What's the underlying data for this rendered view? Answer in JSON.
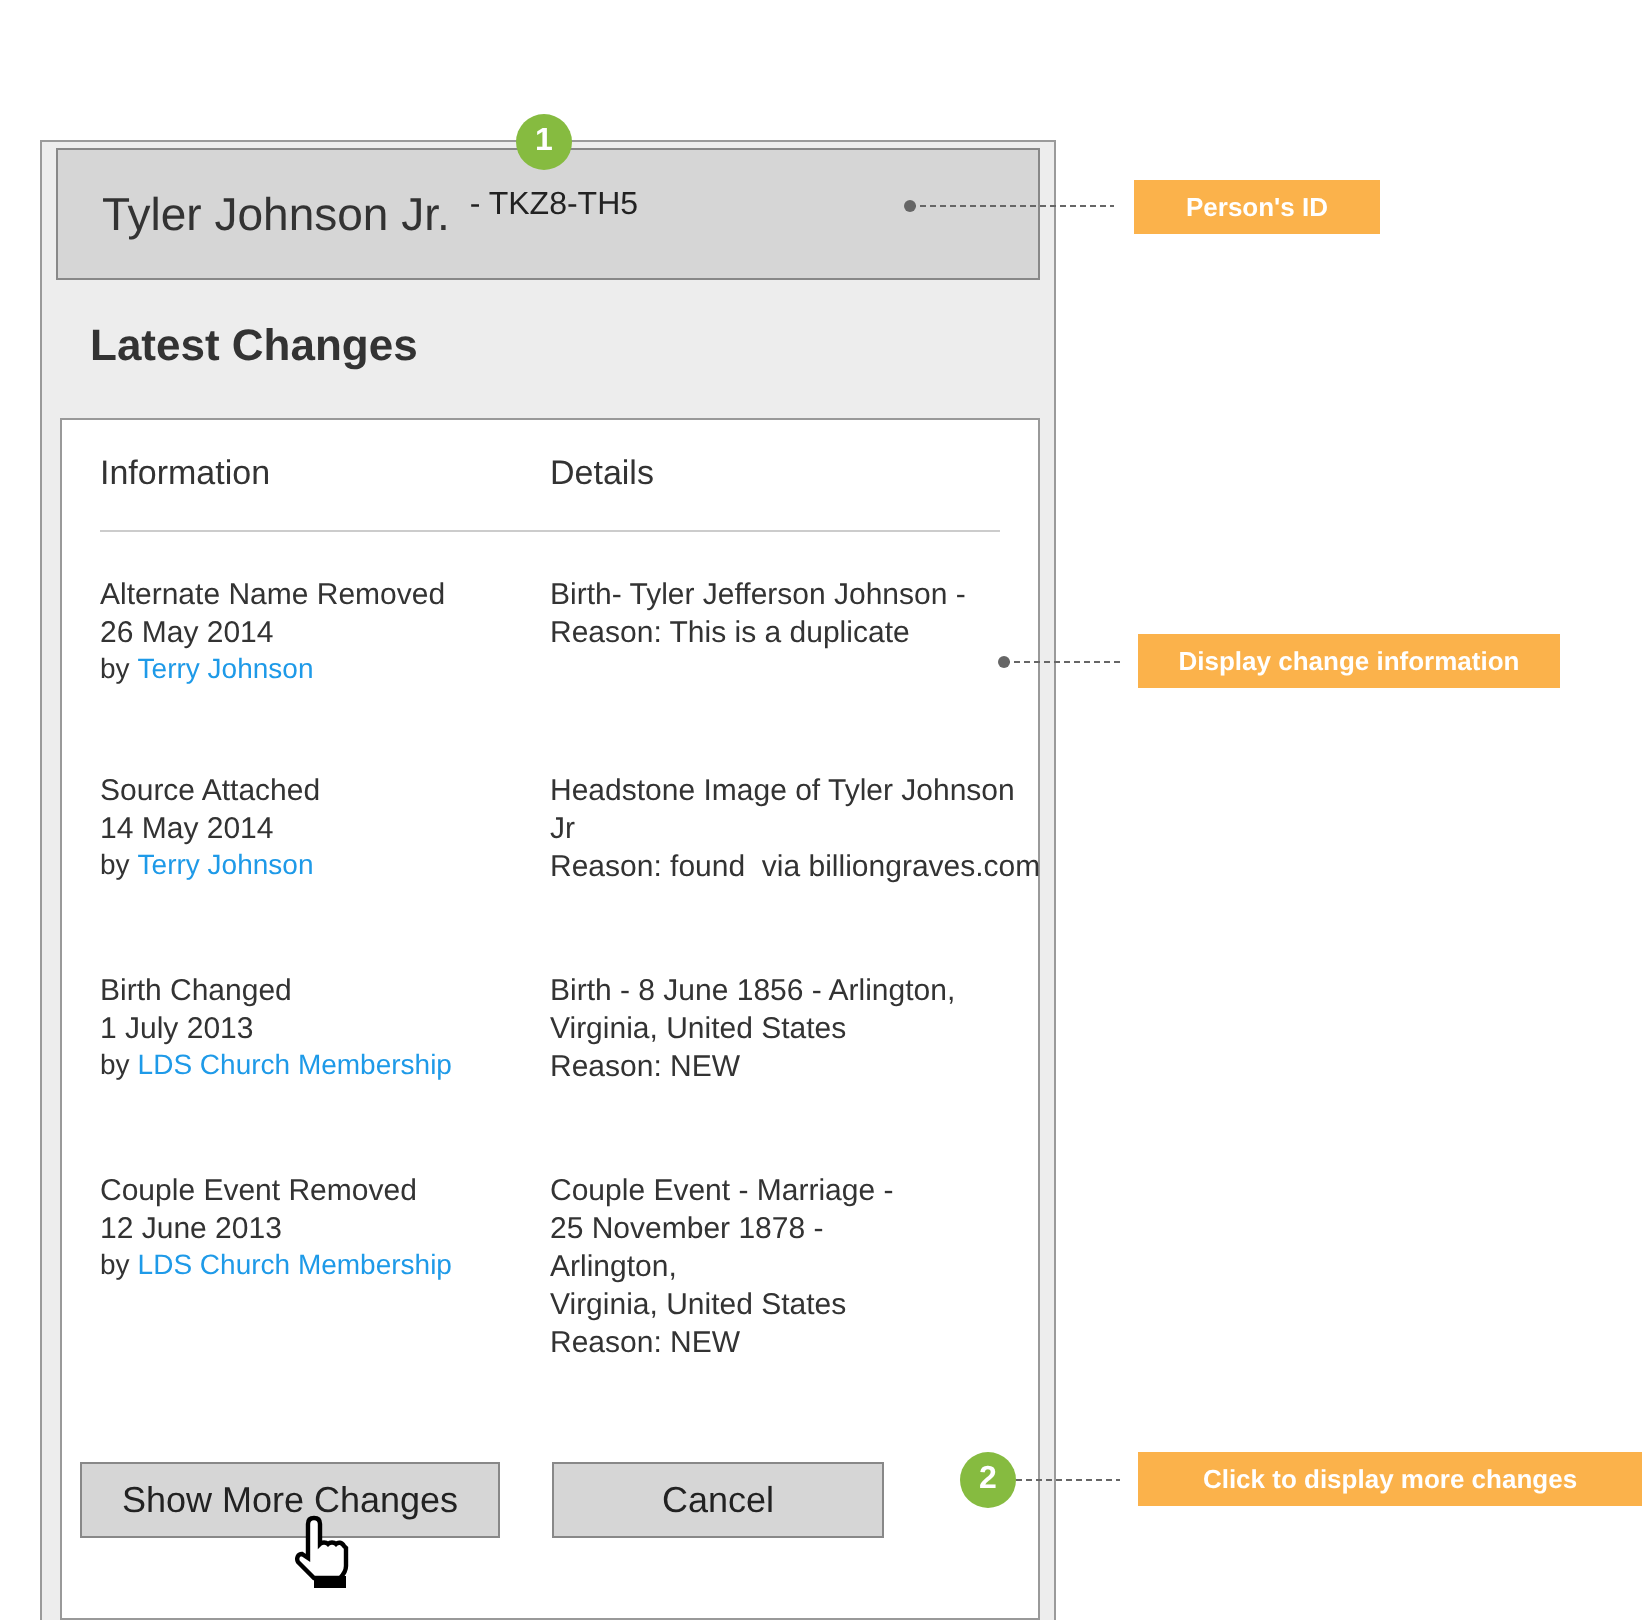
{
  "header": {
    "name": "Tyler Johnson Jr.",
    "person_id": "- TKZ8-TH5"
  },
  "title": "Latest Changes",
  "table": {
    "columns": [
      "Information",
      "Details"
    ],
    "rows": [
      {
        "change": "Alternate Name Removed",
        "date": "26 May 2014",
        "by": "by",
        "author": "Terry Johnson",
        "details": [
          "Birth- Tyler Jefferson Johnson -",
          "Reason: This is a duplicate"
        ]
      },
      {
        "change": "Source Attached",
        "date": "14 May 2014",
        "by": "by",
        "author": "Terry Johnson",
        "details": [
          "Headstone Image of Tyler Johnson",
          "Jr",
          "Reason: found  via billiongraves.com"
        ]
      },
      {
        "change": "Birth Changed",
        "date": "1 July 2013",
        "by": "by",
        "author": "LDS Church Membership",
        "details": [
          "Birth - 8 June 1856 - Arlington,",
          "Virginia, United States",
          "Reason: NEW"
        ]
      },
      {
        "change": "Couple Event Removed",
        "date": "12 June 2013",
        "by": "by",
        "author": "LDS Church Membership",
        "details": [
          "Couple Event - Marriage -",
          "25 November 1878 -",
          "Arlington,",
          "Virginia, United States",
          "Reason: NEW"
        ]
      }
    ]
  },
  "buttons": [
    "Show More Changes",
    "Cancel"
  ],
  "markers": [
    "1",
    "2"
  ],
  "annotations": [
    "Person's ID",
    "Display change information",
    "Click to display more changes"
  ]
}
